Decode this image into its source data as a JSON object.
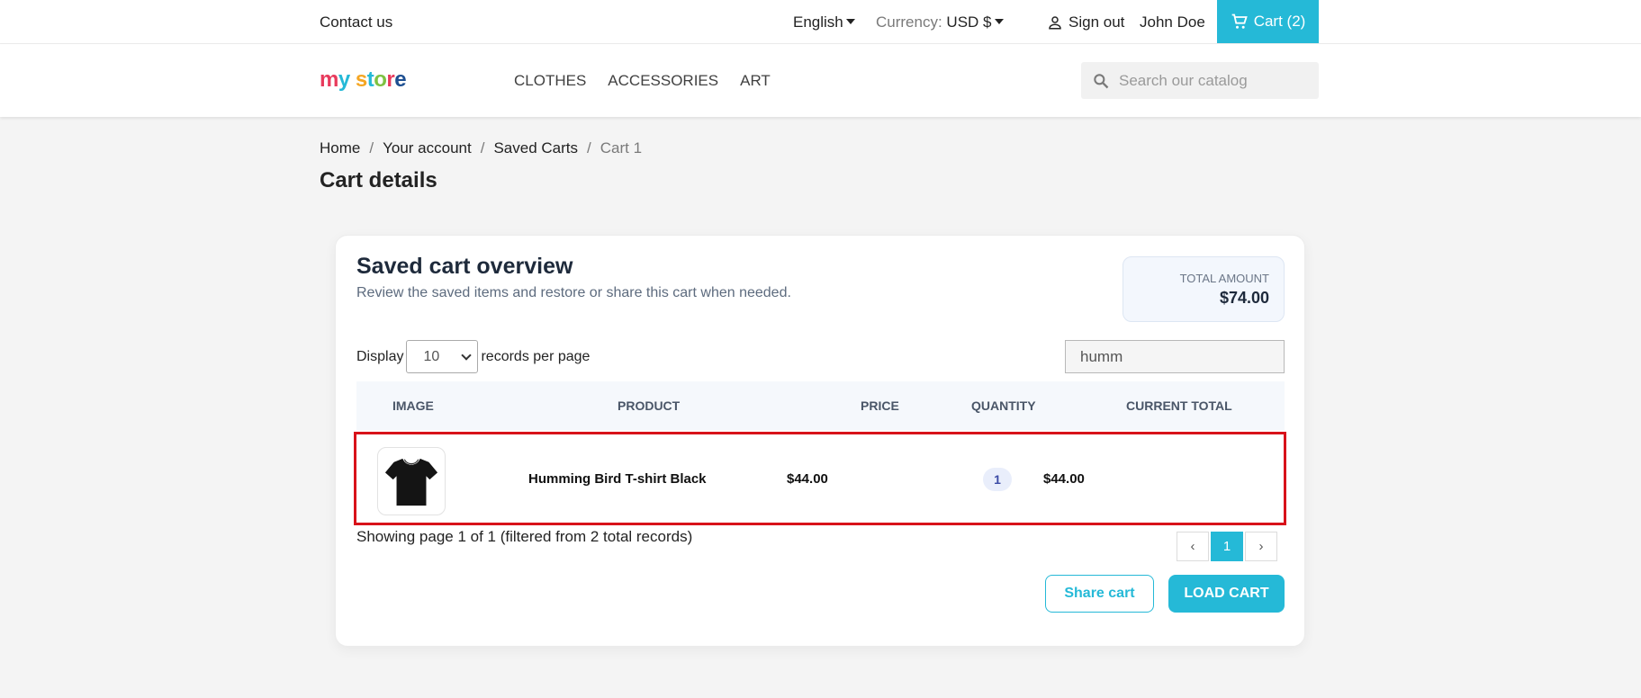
{
  "topbar": {
    "contact": "Contact us",
    "language": "English",
    "currency_label": "Currency:",
    "currency_value": "USD $",
    "sign_out": "Sign out",
    "user_name": "John Doe",
    "cart_label": "Cart (2)"
  },
  "header": {
    "logo_letters": [
      "m",
      "y",
      " ",
      "s",
      "t",
      "o",
      "r",
      "e"
    ],
    "logo_colors": [
      "#e83a5c",
      "#25b9d7",
      "#ffffff",
      "#f5a623",
      "#25b9d7",
      "#7dc242",
      "#e83a5c",
      "#1d4f91"
    ],
    "nav": [
      "CLOTHES",
      "ACCESSORIES",
      "ART"
    ],
    "search_placeholder": "Search our catalog"
  },
  "breadcrumb": {
    "items": [
      "Home",
      "Your account",
      "Saved Carts"
    ],
    "current": "Cart 1",
    "separator": "/"
  },
  "page_title": "Cart details",
  "card": {
    "title": "Saved cart overview",
    "subtitle": "Review the saved items and restore or share this cart when needed.",
    "total_label": "TOTAL AMOUNT",
    "total_value": "$74.00",
    "display_label": "Display",
    "per_page_value": "10",
    "records_label": "records per page",
    "filter_value": "humm",
    "columns": [
      "IMAGE",
      "PRODUCT",
      "PRICE",
      "QUANTITY",
      "CURRENT TOTAL"
    ],
    "rows": [
      {
        "image": "tshirt-icon",
        "product": "Humming Bird T-shirt Black",
        "price": "$44.00",
        "quantity": "1",
        "total": "$44.00"
      }
    ],
    "showing": "Showing page 1 of 1 (filtered from 2 total records)",
    "pager": [
      "‹",
      "1",
      "›"
    ],
    "share_button": "Share cart",
    "load_button": "LOAD CART"
  },
  "colors": {
    "accent": "#25b9d7",
    "highlight": "#d8121a"
  }
}
